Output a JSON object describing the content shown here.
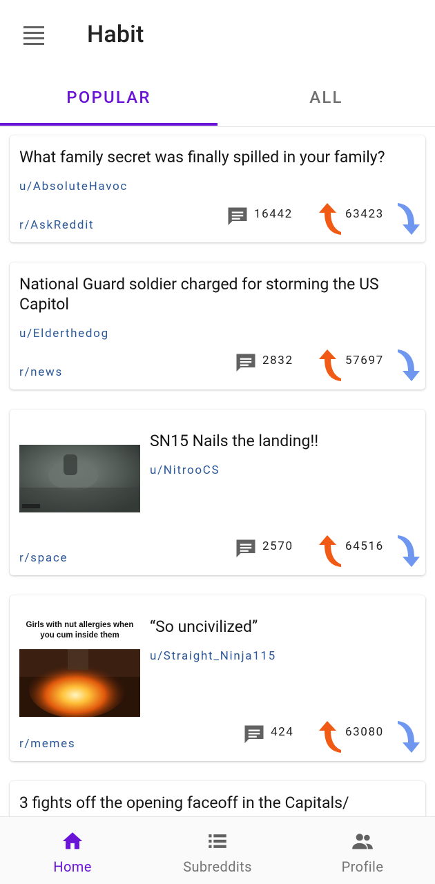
{
  "app": {
    "title": "Habit"
  },
  "tabs": [
    {
      "label": "POPULAR",
      "active": true
    },
    {
      "label": "ALL",
      "active": false
    }
  ],
  "colors": {
    "accent": "#6a14d8",
    "link": "#2b5897",
    "upvote": "#f05a14",
    "downvote": "#6f97f0",
    "icon_grey": "#616161"
  },
  "posts": [
    {
      "title": "What family secret was finally spilled in your family?",
      "user": "u/AbsoluteHavoc",
      "subreddit": "r/AskReddit",
      "comments": "16442",
      "score": "63423",
      "thumbnail": null
    },
    {
      "title": "National Guard soldier charged for storming the US Capitol",
      "user": "u/Elderthedog",
      "subreddit": "r/news",
      "comments": "2832",
      "score": "57697",
      "thumbnail": null
    },
    {
      "title": "SN15 Nails the landing!!",
      "user": "u/NitrooCS",
      "subreddit": "r/space",
      "comments": "2570",
      "score": "64516",
      "thumbnail": "rocket-landing-image"
    },
    {
      "title": "“So uncivilized”",
      "user": "u/Straight_Ninja115",
      "subreddit": "r/memes",
      "comments": "424",
      "score": "63080",
      "thumbnail": "meme-image",
      "thumbnail_caption": "Girls with nut allergies when you cum inside them"
    },
    {
      "title": "3 fights off the opening faceoff in the Capitals/"
    }
  ],
  "bottom_nav": [
    {
      "label": "Home",
      "icon": "home-icon",
      "active": true
    },
    {
      "label": "Subreddits",
      "icon": "list-icon",
      "active": false
    },
    {
      "label": "Profile",
      "icon": "people-icon",
      "active": false
    }
  ]
}
